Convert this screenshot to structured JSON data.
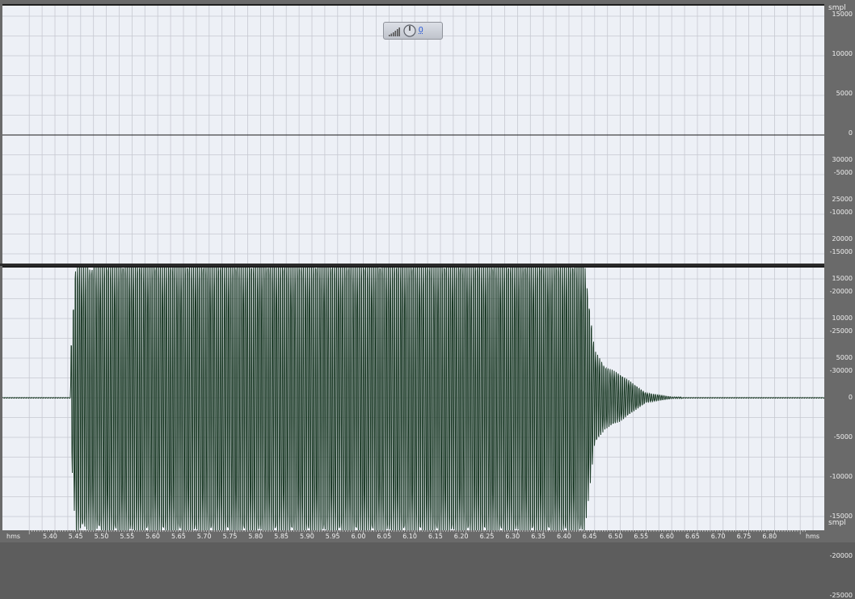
{
  "colors": {
    "background": "#edf0f6",
    "grid": "#c6c9d1",
    "waveform": "#1b3a26",
    "ruler": "#6a6a6a",
    "ruler_text": "#f0f0f0",
    "volume_value": "#1c4fd6"
  },
  "volume_hud": {
    "icon_bars": "volume-bars-icon",
    "icon_knob": "volume-knob-icon",
    "value": "0"
  },
  "vertical_ruler": {
    "unit": "smpl",
    "channel1_ticks": [
      "25000",
      "20000",
      "15000",
      "10000",
      "5000",
      "0",
      "-5000",
      "-10000",
      "-15000",
      "-20000",
      "-25000",
      "-30000"
    ],
    "channel2_ticks": [
      "30000",
      "25000",
      "20000",
      "15000",
      "10000",
      "5000",
      "0",
      "-5000",
      "-10000",
      "-15000",
      "-20000",
      "-25000"
    ]
  },
  "time_ruler": {
    "unit_left": "hms",
    "unit_right": "hms",
    "ticks": [
      "5.40",
      "5.45",
      "5.50",
      "5.55",
      "5.60",
      "5.65",
      "5.70",
      "5.75",
      "5.80",
      "5.85",
      "5.90",
      "5.95",
      "6.00",
      "6.05",
      "6.10",
      "6.15",
      "6.20",
      "6.25",
      "6.30",
      "6.35",
      "6.40",
      "6.45",
      "6.50",
      "6.55",
      "6.60",
      "6.65",
      "6.70",
      "6.75",
      "6.80"
    ]
  },
  "chart_data": [
    {
      "type": "line",
      "x": [
        5.35,
        6.9
      ],
      "values": [
        0,
        0
      ],
      "ylim": [
        -32768,
        32767
      ]
    },
    {
      "type": "line",
      "x": [
        5.35,
        5.42,
        5.43,
        5.44,
        5.45,
        5.47,
        5.5,
        6.0,
        6.43,
        6.45,
        6.47,
        6.5,
        6.55,
        6.6,
        6.9
      ],
      "values": [
        0,
        0,
        5000,
        17000,
        -17000,
        17000,
        17500,
        17500,
        17500,
        6000,
        -4000,
        3000,
        600,
        100,
        0
      ],
      "ylim": [
        -32768,
        32767
      ]
    }
  ]
}
